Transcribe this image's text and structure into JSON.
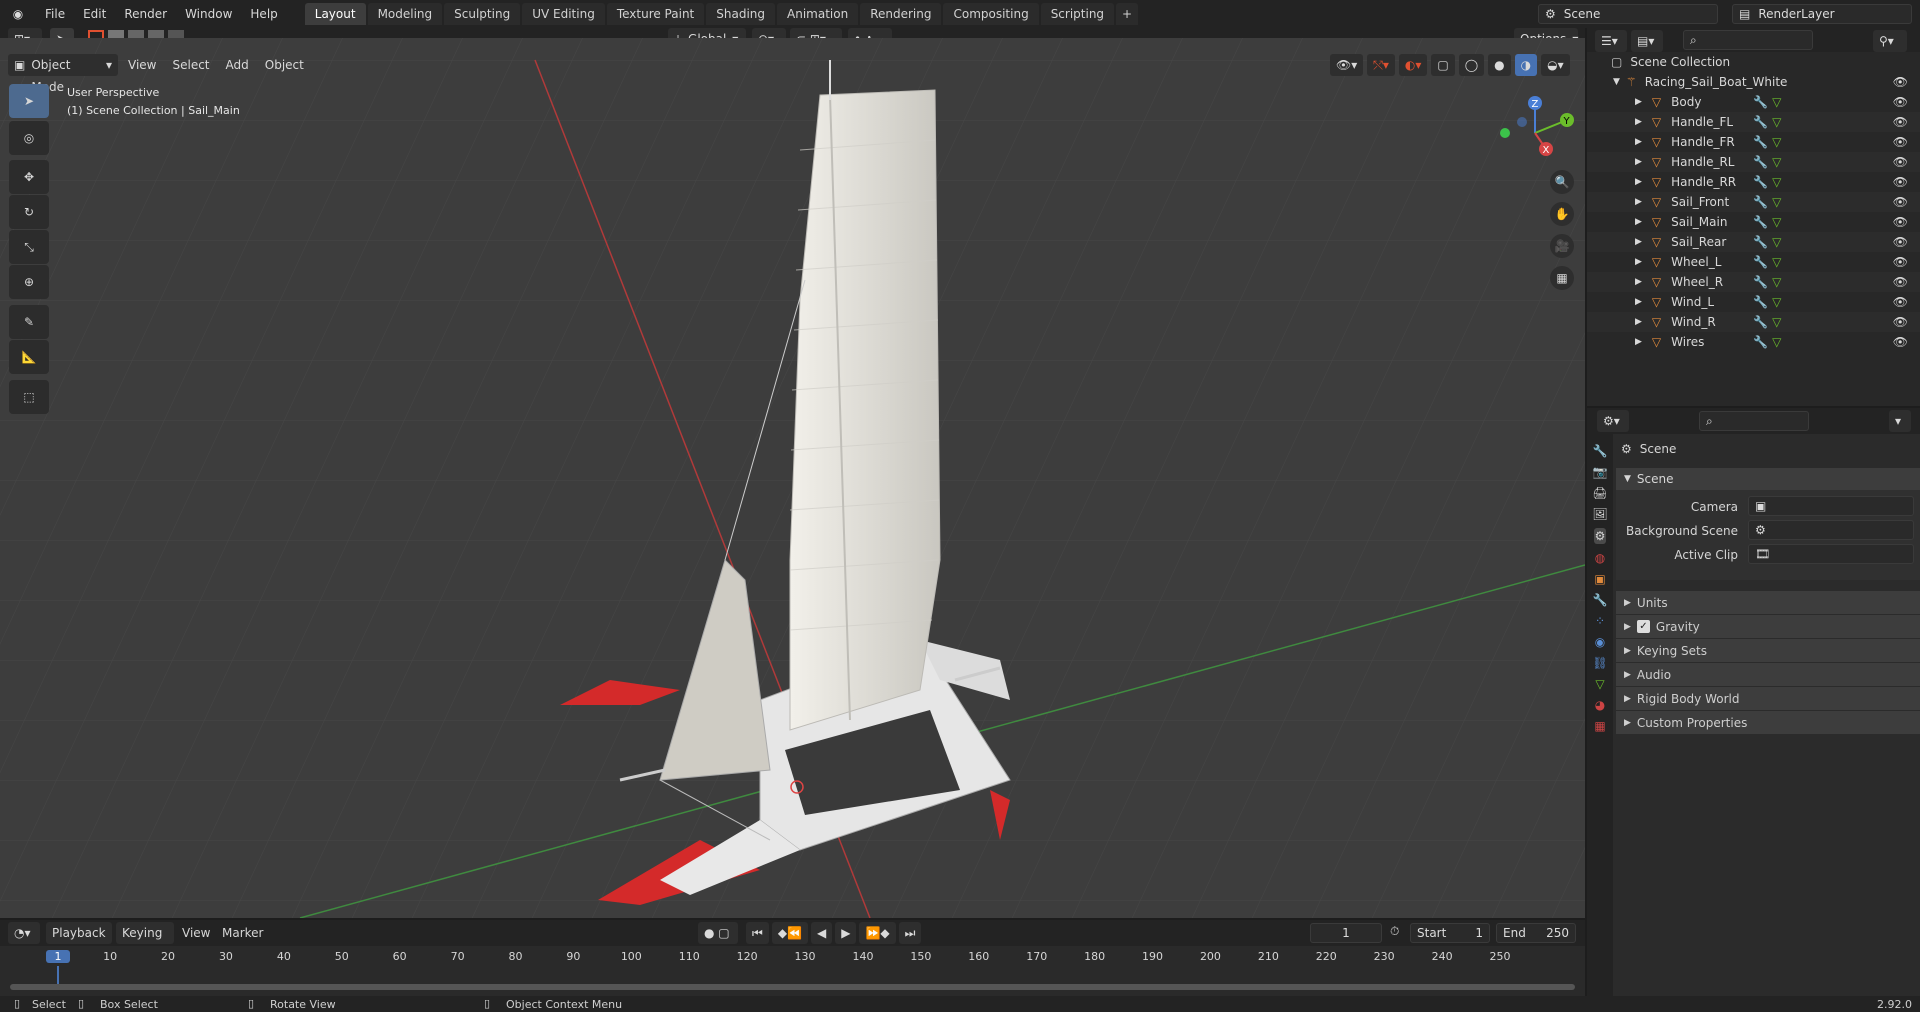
{
  "menu": [
    "File",
    "Edit",
    "Render",
    "Window",
    "Help"
  ],
  "workspaces": [
    "Layout",
    "Modeling",
    "Sculpting",
    "UV Editing",
    "Texture Paint",
    "Shading",
    "Animation",
    "Rendering",
    "Compositing",
    "Scripting"
  ],
  "top_right": {
    "scene": "Scene",
    "render_layer": "RenderLayer"
  },
  "header": {
    "transform": "Global",
    "options": "Options",
    "mode": "Object Mode",
    "view": "View",
    "select": "Select",
    "add": "Add",
    "object": "Object"
  },
  "overlay": {
    "line1": "User Perspective",
    "line2": "(1) Scene Collection | Sail_Main"
  },
  "gizmo": {
    "x": "X",
    "y": "Y",
    "z": "Z"
  },
  "outliner": {
    "root": "Scene Collection",
    "collection": "Racing_Sail_Boat_White",
    "objects": [
      "Body",
      "Handle_FL",
      "Handle_FR",
      "Handle_RL",
      "Handle_RR",
      "Sail_Front",
      "Sail_Main",
      "Sail_Rear",
      "Wheel_L",
      "Wheel_R",
      "Wind_L",
      "Wind_R",
      "Wires"
    ]
  },
  "properties": {
    "context": "Scene",
    "panel": "Scene",
    "camera_label": "Camera",
    "bg_label": "Background Scene",
    "clip_label": "Active Clip",
    "subpanels": [
      "Units",
      "Gravity",
      "Keying Sets",
      "Audio",
      "Rigid Body World",
      "Custom Properties"
    ]
  },
  "timeline": {
    "playback": "Playback",
    "keying": "Keying",
    "view": "View",
    "marker": "Marker",
    "current_frame": "1",
    "start_label": "Start",
    "start": "1",
    "end_label": "End",
    "end": "250",
    "ticks": [
      "1",
      "10",
      "20",
      "30",
      "40",
      "50",
      "60",
      "70",
      "80",
      "90",
      "100",
      "110",
      "120",
      "130",
      "140",
      "150",
      "160",
      "170",
      "180",
      "190",
      "200",
      "210",
      "220",
      "230",
      "240",
      "250"
    ]
  },
  "status": {
    "select": "Select",
    "box_select": "Box Select",
    "rotate": "Rotate View",
    "context": "Object Context Menu",
    "version": "2.92.0"
  },
  "colors": {
    "accent": "#4772b3",
    "orange": "#e08a3c",
    "hull_red": "#d42a2a",
    "viewport": "#3d3d3d"
  }
}
